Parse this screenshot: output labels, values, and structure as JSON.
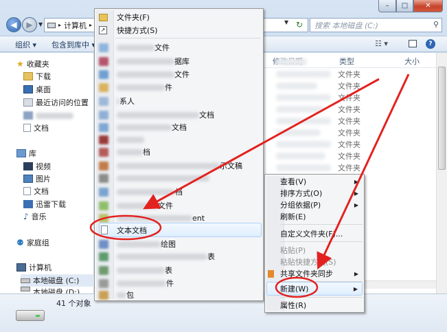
{
  "window": {
    "caption_buttons": {
      "minimize": "–",
      "maximize": "□",
      "close": "✕"
    }
  },
  "address": {
    "path_root": "计算机",
    "path_separator": "▸",
    "search_placeholder": "搜索 本地磁盘 (C:)"
  },
  "toolbar": {
    "organize": "组织 ▾",
    "include_in_library": "包含到库中 ▾"
  },
  "nav": {
    "favorites": "收藏夹",
    "downloads": "下载",
    "desktop": "桌面",
    "recent": "最近访问的位置",
    "documents_fav": "文档",
    "libraries": "库",
    "videos": "视频",
    "pictures": "图片",
    "documents": "文档",
    "thunder": "迅雷下载",
    "music": "音乐",
    "homegroup": "家庭组",
    "computer": "计算机",
    "local_c": "本地磁盘 (C:)",
    "local_d": "本地磁盘 (D:)"
  },
  "columns": {
    "modified": "修改日期",
    "type": "类型",
    "size": "大小"
  },
  "rows": {
    "type_folder": "文件夹"
  },
  "details": {
    "count": "41 个对象"
  },
  "submenu": {
    "folder": "文件夹(F)",
    "shortcut": "快捷方式(S)",
    "frag_1": "文件",
    "frag_2": "据库",
    "frag_3": "文件",
    "frag_4": "件",
    "frag_5": "系人",
    "frag_6": "文档",
    "frag_7": "文档",
    "frag_8": "档",
    "frag_9": "示文稿",
    "frag_10": "档",
    "frag_11": "文件",
    "frag_12": "ent",
    "text_doc": "文本文档",
    "frag_13": "绘图",
    "frag_14": "表",
    "frag_15": "表",
    "frag_16": "件",
    "frag_17": "包"
  },
  "context_menu": {
    "view": "查看(V)",
    "sort": "排序方式(O)",
    "group": "分组依据(P)",
    "refresh": "刷新(E)",
    "customize": "自定义文件夹(F)...",
    "paste": "粘贴(P)",
    "paste_shortcut": "粘贴快捷方式(S)",
    "share_sync": "共享文件夹同步",
    "new": "新建(W)",
    "properties": "属性(R)"
  },
  "colors": {
    "annotation_red": "#e2221f",
    "accent_blue": "#2f66b3"
  }
}
